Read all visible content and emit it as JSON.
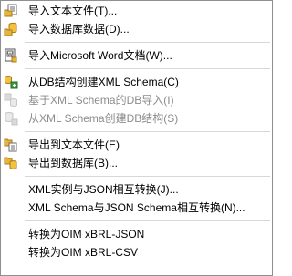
{
  "menu": {
    "items": [
      {
        "label": "导入文本文件(T)...",
        "icon": "import-text-file-icon",
        "enabled": true
      },
      {
        "label": "导入数据库数据(D)...",
        "icon": "import-database-icon",
        "enabled": true
      },
      {
        "separator": true
      },
      {
        "label": "导入Microsoft Word文档(W)...",
        "icon": "word-document-icon",
        "enabled": true
      },
      {
        "separator": true
      },
      {
        "label": "从DB结构创建XML Schema(C)",
        "icon": "create-schema-from-db-icon",
        "enabled": true
      },
      {
        "label": "基于XML Schema的DB导入(I)",
        "icon": "db-import-icon",
        "enabled": false
      },
      {
        "label": "从XML Schema创建DB结构(S)",
        "icon": "create-db-icon",
        "enabled": false
      },
      {
        "separator": true
      },
      {
        "label": "导出到文本文件(E)",
        "icon": "export-text-file-icon",
        "enabled": true
      },
      {
        "label": "导出到数据库(B)...",
        "icon": "export-database-icon",
        "enabled": true
      },
      {
        "separator": true
      },
      {
        "label": "XML实例与JSON相互转换(J)...",
        "icon": "",
        "enabled": true
      },
      {
        "label": "XML Schema与JSON Schema相互转换(N)...",
        "icon": "",
        "enabled": true
      },
      {
        "separator": true
      },
      {
        "label": "转换为OIM xBRL-JSON",
        "icon": "",
        "enabled": true
      },
      {
        "label": "转换为OIM xBRL-CSV",
        "icon": "",
        "enabled": true
      }
    ]
  },
  "colors": {
    "folder_yellow": "#e8b53a",
    "db_yellow": "#f2c23e",
    "green_arrow": "#3a9a3a",
    "disabled_text": "#8c8c8c"
  }
}
